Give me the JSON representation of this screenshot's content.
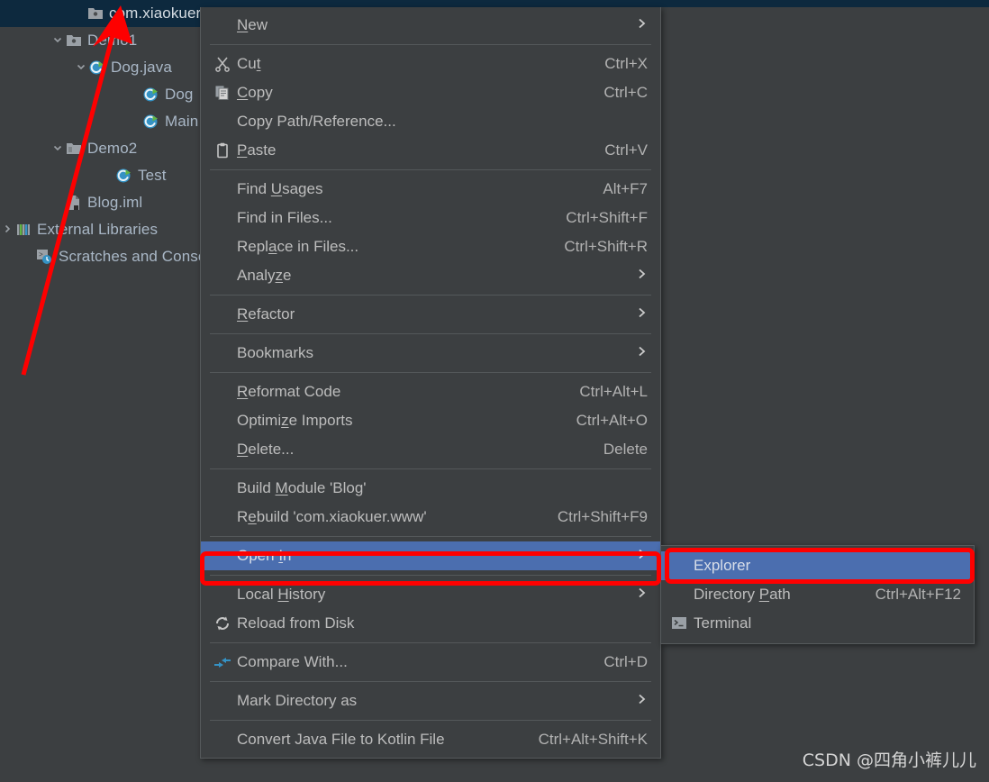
{
  "app": {
    "theme_bg": "#3c3f41",
    "selection_blue": "#4b6eaf",
    "tree_selection_navy": "#0d293e",
    "annotation_red": "#fe0000"
  },
  "project_tree": {
    "rows": [
      {
        "label": "com.xiaokuer",
        "icon": "package-folder-icon",
        "indent": 80,
        "twisty": "",
        "selected": true
      },
      {
        "label": "Demo1",
        "icon": "package-folder-icon",
        "indent": 56,
        "twisty": "v",
        "selected": false
      },
      {
        "label": "Dog.java",
        "icon": "java-class-icon",
        "indent": 82,
        "twisty": "v",
        "selected": false
      },
      {
        "label": "Dog",
        "icon": "java-class-icon",
        "indent": 142,
        "twisty": "",
        "selected": false
      },
      {
        "label": "Main",
        "icon": "java-class-icon",
        "indent": 142,
        "twisty": "",
        "selected": false
      },
      {
        "label": "Demo2",
        "icon": "folder-icon",
        "indent": 56,
        "twisty": "v",
        "selected": false
      },
      {
        "label": "Test",
        "icon": "java-class-icon",
        "indent": 112,
        "twisty": "",
        "selected": false
      },
      {
        "label": "Blog.iml",
        "icon": "iml-file-icon",
        "indent": 56,
        "twisty": "",
        "selected": false
      },
      {
        "label": "External Libraries",
        "icon": "libraries-icon",
        "indent": 0,
        "twisty": ">",
        "selected": false
      },
      {
        "label": "Scratches and Consoles",
        "icon": "scratches-icon",
        "indent": 24,
        "twisty": "",
        "selected": false
      }
    ]
  },
  "context_menu": {
    "groups": [
      {
        "items": [
          {
            "label": "New",
            "accel": "",
            "arrow": true,
            "icon": "",
            "mnemonic": "N",
            "highlight": false
          }
        ]
      },
      {
        "items": [
          {
            "label": "Cut",
            "accel": "Ctrl+X",
            "arrow": false,
            "icon": "scissors-icon",
            "mnemonic": "t",
            "highlight": false
          },
          {
            "label": "Copy",
            "accel": "Ctrl+C",
            "arrow": false,
            "icon": "copy-icon",
            "mnemonic": "C",
            "highlight": false
          },
          {
            "label": "Copy Path/Reference...",
            "accel": "",
            "arrow": false,
            "icon": "",
            "mnemonic": "",
            "highlight": false
          },
          {
            "label": "Paste",
            "accel": "Ctrl+V",
            "arrow": false,
            "icon": "clipboard-icon",
            "mnemonic": "P",
            "highlight": false
          }
        ]
      },
      {
        "items": [
          {
            "label": "Find Usages",
            "accel": "Alt+F7",
            "arrow": false,
            "icon": "",
            "mnemonic": "U",
            "highlight": false
          },
          {
            "label": "Find in Files...",
            "accel": "Ctrl+Shift+F",
            "arrow": false,
            "icon": "",
            "mnemonic": "",
            "highlight": false
          },
          {
            "label": "Replace in Files...",
            "accel": "Ctrl+Shift+R",
            "arrow": false,
            "icon": "",
            "mnemonic": "a",
            "highlight": false
          },
          {
            "label": "Analyze",
            "accel": "",
            "arrow": true,
            "icon": "",
            "mnemonic": "z",
            "highlight": false
          }
        ]
      },
      {
        "items": [
          {
            "label": "Refactor",
            "accel": "",
            "arrow": true,
            "icon": "",
            "mnemonic": "R",
            "highlight": false
          }
        ]
      },
      {
        "items": [
          {
            "label": "Bookmarks",
            "accel": "",
            "arrow": true,
            "icon": "",
            "mnemonic": "",
            "highlight": false
          }
        ]
      },
      {
        "items": [
          {
            "label": "Reformat Code",
            "accel": "Ctrl+Alt+L",
            "arrow": false,
            "icon": "",
            "mnemonic": "R",
            "highlight": false
          },
          {
            "label": "Optimize Imports",
            "accel": "Ctrl+Alt+O",
            "arrow": false,
            "icon": "",
            "mnemonic": "z",
            "highlight": false
          },
          {
            "label": "Delete...",
            "accel": "Delete",
            "arrow": false,
            "icon": "",
            "mnemonic": "D",
            "highlight": false
          }
        ]
      },
      {
        "items": [
          {
            "label": "Build Module 'Blog'",
            "accel": "",
            "arrow": false,
            "icon": "",
            "mnemonic": "M",
            "highlight": false
          },
          {
            "label": "Rebuild 'com.xiaokuer.www'",
            "accel": "Ctrl+Shift+F9",
            "arrow": false,
            "icon": "",
            "mnemonic": "e",
            "highlight": false
          }
        ]
      },
      {
        "items": [
          {
            "label": "Open In",
            "accel": "",
            "arrow": true,
            "icon": "",
            "mnemonic": "I",
            "highlight": true
          }
        ]
      },
      {
        "items": [
          {
            "label": "Local History",
            "accel": "",
            "arrow": true,
            "icon": "",
            "mnemonic": "H",
            "highlight": false
          },
          {
            "label": "Reload from Disk",
            "accel": "",
            "arrow": false,
            "icon": "refresh-icon",
            "mnemonic": "",
            "highlight": false
          }
        ]
      },
      {
        "items": [
          {
            "label": "Compare With...",
            "accel": "Ctrl+D",
            "arrow": false,
            "icon": "compare-icon",
            "mnemonic": "",
            "highlight": false
          }
        ]
      },
      {
        "items": [
          {
            "label": "Mark Directory as",
            "accel": "",
            "arrow": true,
            "icon": "",
            "mnemonic": "",
            "highlight": false
          }
        ]
      },
      {
        "items": [
          {
            "label": "Convert Java File to Kotlin File",
            "accel": "Ctrl+Alt+Shift+K",
            "arrow": false,
            "icon": "",
            "mnemonic": "",
            "highlight": false
          }
        ]
      }
    ]
  },
  "submenu": {
    "items": [
      {
        "label": "Explorer",
        "accel": "",
        "icon": "",
        "highlight": true
      },
      {
        "label": "Directory Path",
        "accel": "Ctrl+Alt+F12",
        "icon": "",
        "highlight": false
      },
      {
        "label": "Terminal",
        "accel": "",
        "icon": "terminal-icon",
        "highlight": false
      }
    ]
  },
  "watermark": {
    "text": "CSDN @四角小裤儿儿"
  }
}
